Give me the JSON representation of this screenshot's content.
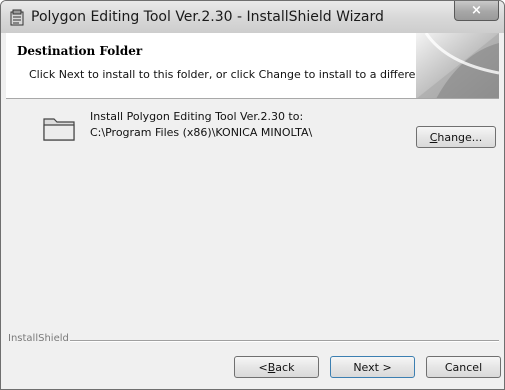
{
  "window": {
    "title": "Polygon Editing Tool Ver.2.30 - InstallShield Wizard",
    "close_symbol": "×",
    "app_icon": "installer-icon",
    "close_icon": "close-icon"
  },
  "header": {
    "title": "Destination Folder",
    "subtitle": "Click Next to install to this folder, or click Change to install to a different folder."
  },
  "destination": {
    "folder_icon": "folder-icon",
    "install_label": "Install Polygon Editing Tool Ver.2.30 to:",
    "path": "C:\\Program Files (x86)\\KONICA MINOLTA\\"
  },
  "buttons": {
    "change_pre": "",
    "change_acc": "C",
    "change_post": "hange...",
    "back_pre": "< ",
    "back_acc": "B",
    "back_post": "ack",
    "next": "Next >",
    "cancel": "Cancel"
  },
  "footer": {
    "brand": "InstallShield"
  }
}
